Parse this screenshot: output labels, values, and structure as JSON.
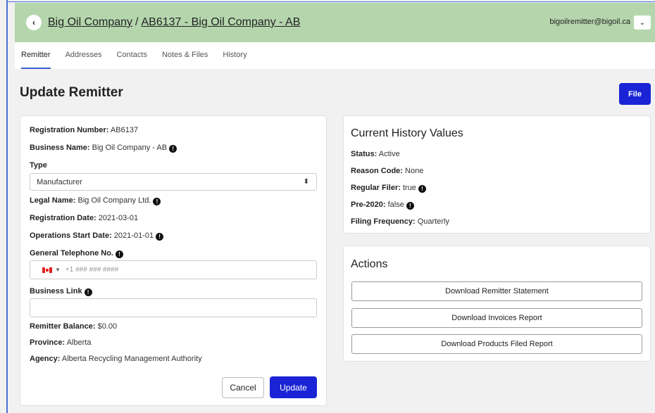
{
  "header": {
    "back_glyph": "‹",
    "company_link": "Big Oil Company",
    "separator": "/",
    "remitter_link": "AB6137 - Big Oil Company - AB",
    "user_email": "bigoilremitter@bigoil.ca",
    "user_dropdown_glyph": "⌄"
  },
  "tabs": [
    {
      "label": "Remitter",
      "active": true
    },
    {
      "label": "Addresses"
    },
    {
      "label": "Contacts"
    },
    {
      "label": "Notes & Files"
    },
    {
      "label": "History"
    }
  ],
  "page": {
    "title": "Update Remitter",
    "file_button": "File"
  },
  "form": {
    "registration_number": {
      "label": "Registration Number:",
      "value": "AB6137"
    },
    "business_name": {
      "label": "Business Name:",
      "value": "Big Oil Company - AB"
    },
    "type": {
      "label": "Type",
      "selected": "Manufacturer"
    },
    "legal_name": {
      "label": "Legal Name:",
      "value": "Big Oil Company Ltd."
    },
    "registration_date": {
      "label": "Registration Date:",
      "value": "2021-03-01"
    },
    "operations_start_date": {
      "label": "Operations Start Date:",
      "value": "2021-01-01"
    },
    "general_telephone": {
      "label": "General Telephone No.",
      "placeholder": "+1 ### ### ####"
    },
    "business_link": {
      "label": "Business Link",
      "value": ""
    },
    "remitter_balance": {
      "label": "Remitter Balance:",
      "value": "$0.00"
    },
    "province": {
      "label": "Province:",
      "value": "Alberta"
    },
    "agency": {
      "label": "Agency:",
      "value": "Alberta Recycling Management Authority"
    },
    "cancel_button": "Cancel",
    "update_button": "Update",
    "info_glyph": "!"
  },
  "history": {
    "heading": "Current History Values",
    "status": {
      "label": "Status:",
      "value": "Active"
    },
    "reason_code": {
      "label": "Reason Code:",
      "value": "None"
    },
    "regular_filer": {
      "label": "Regular Filer:",
      "value": "true"
    },
    "pre_2020": {
      "label": "Pre-2020:",
      "value": "false"
    },
    "filing_frequency": {
      "label": "Filing Frequency:",
      "value": "Quarterly"
    }
  },
  "actions": {
    "heading": "Actions",
    "buttons": [
      "Download Remitter Statement",
      "Download Invoices Report",
      "Download Products Filed Report"
    ]
  },
  "colors": {
    "header_bg": "#b5d6ad",
    "primary_button": "#1a24d6",
    "active_tab_underline": "#3a5fd0"
  }
}
